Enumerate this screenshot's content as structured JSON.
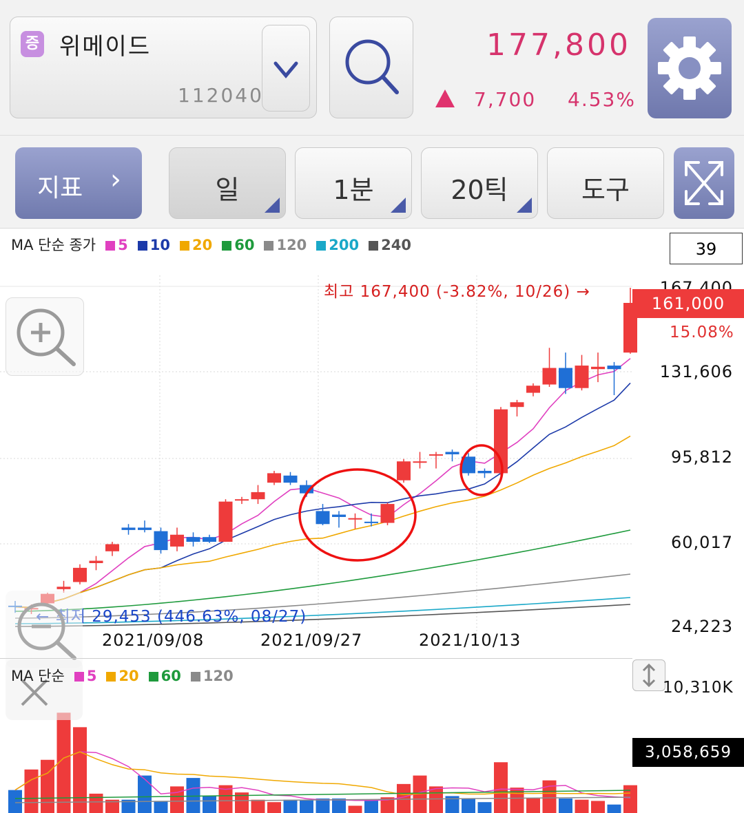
{
  "stock": {
    "badge": "증",
    "name": "위메이드",
    "code": "112040"
  },
  "quote": {
    "price": "177,800",
    "change": "7,700",
    "change_pct": "4.53%",
    "direction": "up"
  },
  "icons": {
    "dropdown": "chevron-down-icon",
    "search": "search-icon",
    "settings": "gear-icon",
    "expand": "expand-icon",
    "zoom_in": "zoom-in-icon",
    "zoom_out": "zoom-out-icon",
    "close": "close-icon",
    "resize": "vertical-resize-icon"
  },
  "toolbar": {
    "indicator_label": "지표",
    "period": "일",
    "minute": "1분",
    "tick": "20틱",
    "tools": "도구"
  },
  "price_legend": {
    "prefix": "MA 단순 종가",
    "items": [
      {
        "label": "5",
        "color": "#e040c0"
      },
      {
        "label": "10",
        "color": "#1c3aa9"
      },
      {
        "label": "20",
        "color": "#f0a800"
      },
      {
        "label": "60",
        "color": "#1e9a3c"
      },
      {
        "label": "120",
        "color": "#8a8a8a"
      },
      {
        "label": "200",
        "color": "#1aa8c8"
      },
      {
        "label": "240",
        "color": "#555555"
      }
    ]
  },
  "visible_count": "39",
  "annotations": {
    "high": "최고 167,400 (-3.82%, 10/26) →",
    "low": "← 최저 29,453 (446.63%, 08/27)"
  },
  "y_axis": {
    "top": "167,400",
    "labels": [
      "131,606",
      "95,812",
      "60,017",
      "24,223"
    ]
  },
  "current": {
    "price": "161,000",
    "pct": "15.08%"
  },
  "x_axis": {
    "labels": [
      "2021/09/08",
      "2021/09/27",
      "2021/10/13"
    ]
  },
  "volume_legend": {
    "prefix": "MA 단순",
    "items": [
      {
        "label": "5",
        "color": "#e040c0"
      },
      {
        "label": "20",
        "color": "#f0a800"
      },
      {
        "label": "60",
        "color": "#1e9a3c"
      },
      {
        "label": "120",
        "color": "#8a8a8a"
      }
    ]
  },
  "volume": {
    "max": "10,310K",
    "current": "3,058,659"
  },
  "chart_data": {
    "type": "candlestick",
    "price_range": [
      24223,
      167400
    ],
    "candles": [
      {
        "o": 33000,
        "h": 35000,
        "l": 30000,
        "c": 32500
      },
      {
        "o": 31500,
        "h": 33500,
        "l": 29453,
        "c": 32000
      },
      {
        "o": 34000,
        "h": 38500,
        "l": 33000,
        "c": 38000
      },
      {
        "o": 40000,
        "h": 43500,
        "l": 38500,
        "c": 41000
      },
      {
        "o": 43000,
        "h": 50500,
        "l": 42000,
        "c": 49000
      },
      {
        "o": 51000,
        "h": 54000,
        "l": 48000,
        "c": 52000
      },
      {
        "o": 56000,
        "h": 60000,
        "l": 54000,
        "c": 59000
      },
      {
        "o": 66000,
        "h": 67500,
        "l": 63000,
        "c": 65000
      },
      {
        "o": 66000,
        "h": 69000,
        "l": 64000,
        "c": 65000
      },
      {
        "o": 64500,
        "h": 66000,
        "l": 55000,
        "c": 56500
      },
      {
        "o": 58000,
        "h": 66000,
        "l": 56000,
        "c": 63000
      },
      {
        "o": 62000,
        "h": 64000,
        "l": 58000,
        "c": 60000
      },
      {
        "o": 62000,
        "h": 63000,
        "l": 59500,
        "c": 60000
      },
      {
        "o": 60000,
        "h": 78000,
        "l": 60000,
        "c": 77000
      },
      {
        "o": 78000,
        "h": 79000,
        "l": 76000,
        "c": 78000
      },
      {
        "o": 78000,
        "h": 84000,
        "l": 76000,
        "c": 81000
      },
      {
        "o": 85000,
        "h": 90000,
        "l": 84000,
        "c": 89000
      },
      {
        "o": 88000,
        "h": 89500,
        "l": 84000,
        "c": 85000
      },
      {
        "o": 84000,
        "h": 86000,
        "l": 79000,
        "c": 80500
      },
      {
        "o": 73000,
        "h": 76000,
        "l": 67000,
        "c": 67500
      },
      {
        "o": 71500,
        "h": 73000,
        "l": 66000,
        "c": 70500
      },
      {
        "o": 69500,
        "h": 72000,
        "l": 65500,
        "c": 70000
      },
      {
        "o": 68500,
        "h": 72000,
        "l": 66500,
        "c": 68000
      },
      {
        "o": 68000,
        "h": 76500,
        "l": 67000,
        "c": 76000
      },
      {
        "o": 86000,
        "h": 95000,
        "l": 85000,
        "c": 94000
      },
      {
        "o": 94000,
        "h": 98000,
        "l": 91000,
        "c": 94000
      },
      {
        "o": 97000,
        "h": 98000,
        "l": 91000,
        "c": 97000
      },
      {
        "o": 98000,
        "h": 99000,
        "l": 94000,
        "c": 97000
      },
      {
        "o": 96000,
        "h": 97500,
        "l": 88000,
        "c": 89000
      },
      {
        "o": 90000,
        "h": 91000,
        "l": 87000,
        "c": 89000
      },
      {
        "o": 89000,
        "h": 117000,
        "l": 88000,
        "c": 116000
      },
      {
        "o": 117000,
        "h": 120000,
        "l": 113000,
        "c": 119000
      },
      {
        "o": 123000,
        "h": 127000,
        "l": 121500,
        "c": 126000
      },
      {
        "o": 126500,
        "h": 142000,
        "l": 125500,
        "c": 133500
      },
      {
        "o": 133500,
        "h": 140000,
        "l": 122500,
        "c": 125000
      },
      {
        "o": 125000,
        "h": 139000,
        "l": 124000,
        "c": 134500
      },
      {
        "o": 133000,
        "h": 140000,
        "l": 127500,
        "c": 134000
      },
      {
        "o": 134500,
        "h": 136000,
        "l": 122000,
        "c": 133000
      },
      {
        "o": 140000,
        "h": 167400,
        "l": 139500,
        "c": 161000
      }
    ],
    "volume": [
      1.9,
      3.6,
      4.4,
      8.3,
      7.1,
      1.6,
      1.1,
      1.1,
      3.1,
      1.0,
      2.2,
      2.9,
      1.4,
      2.3,
      1.7,
      1.1,
      0.9,
      1.1,
      1.1,
      1.2,
      1.2,
      0.6,
      1.1,
      1.3,
      2.4,
      3.1,
      2.2,
      1.4,
      1.2,
      0.9,
      4.2,
      2.1,
      1.2,
      2.7,
      1.2,
      1.1,
      1.0,
      0.7,
      2.3
    ],
    "volume_unit": "M",
    "volume_max_label": "10,310K"
  }
}
